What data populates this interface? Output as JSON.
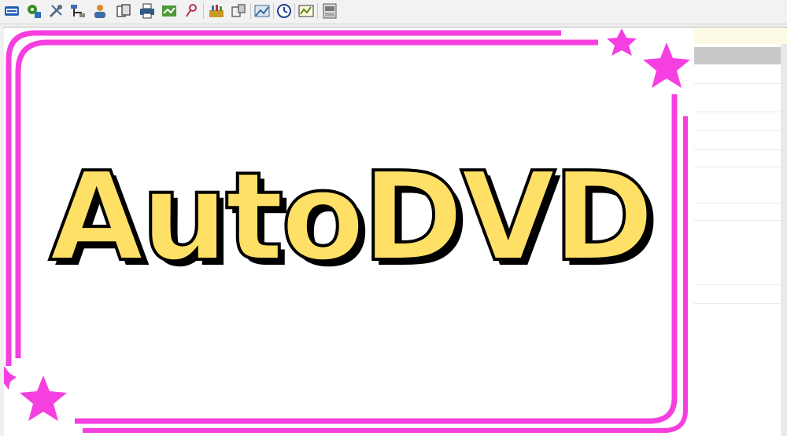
{
  "toolbar": {
    "buttons": [
      {
        "name": "abc-text-button",
        "icon": "abc-text-icon",
        "color": "#1f5fb0"
      },
      {
        "name": "gear-puzzle-button",
        "icon": "gear-puzzle-icon",
        "color": "#3a8a2a"
      },
      {
        "name": "tools-button",
        "icon": "tools-icon",
        "color": "#5b6b7b"
      },
      {
        "name": "network-button",
        "icon": "network-icon",
        "color": "#3c6ea8"
      },
      {
        "name": "user-button",
        "icon": "user-icon",
        "color": "#d98c2b"
      },
      {
        "name": "copy-button",
        "icon": "copy-icon",
        "color": "#555555"
      },
      {
        "name": "print-button",
        "icon": "print-icon",
        "color": "#2d5d8a"
      },
      {
        "name": "map-button",
        "icon": "map-icon",
        "color": "#4c9a3a"
      },
      {
        "name": "link-button",
        "icon": "link-icon",
        "color": "#c0304a"
      },
      {
        "name": "toolbox-button",
        "icon": "toolbox-icon",
        "color": "#c99a22"
      },
      {
        "name": "device-button",
        "icon": "device-icon",
        "color": "#666666"
      },
      {
        "name": "image-button",
        "icon": "image-icon",
        "color": "#3b6aa0"
      },
      {
        "name": "clock-button",
        "icon": "clock-icon",
        "color": "#1e3f8a"
      },
      {
        "name": "chart-button",
        "icon": "chart-icon",
        "color": "#5a8a1a"
      },
      {
        "name": "window-button",
        "icon": "window-icon",
        "color": "#777777"
      }
    ]
  },
  "splash": {
    "title": "AutoDVD",
    "title_color": "#ffe066",
    "frame_color": "#f53fe0"
  }
}
